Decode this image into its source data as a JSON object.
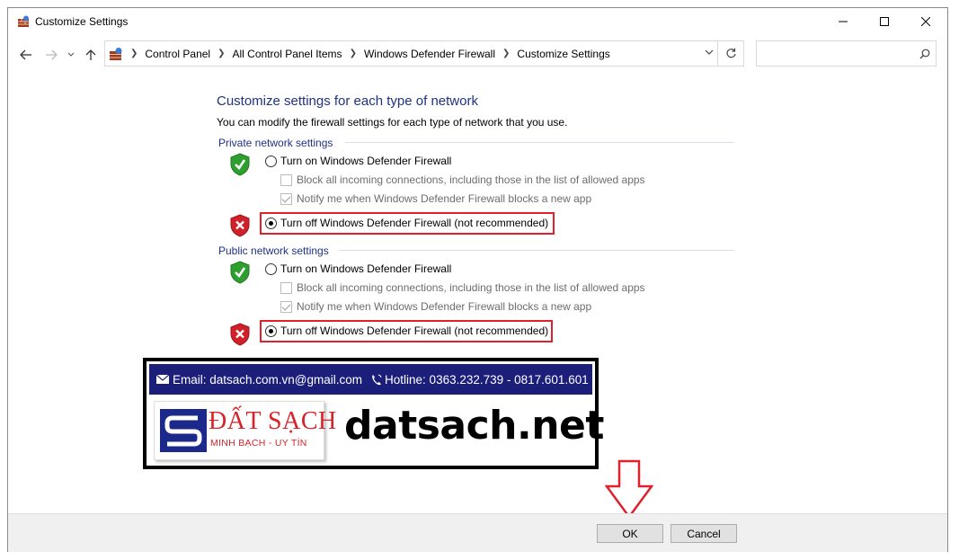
{
  "window": {
    "title": "Customize Settings"
  },
  "address_bar": {
    "breadcrumbs": [
      "Control Panel",
      "All Control Panel Items",
      "Windows Defender Firewall",
      "Customize Settings"
    ],
    "search_placeholder": ""
  },
  "content": {
    "heading": "Customize settings for each type of network",
    "description": "You can modify the firewall settings for each type of network that you use.",
    "private": {
      "title": "Private network settings",
      "turn_on_label": "Turn on Windows Defender Firewall",
      "turn_on_selected": false,
      "block_label": "Block all incoming connections, including those in the list of allowed apps",
      "block_checked": false,
      "notify_label": "Notify me when Windows Defender Firewall blocks a new app",
      "notify_checked": true,
      "turn_off_label": "Turn off Windows Defender Firewall (not recommended)",
      "turn_off_selected": true
    },
    "public": {
      "title": "Public network settings",
      "turn_on_label": "Turn on Windows Defender Firewall",
      "turn_on_selected": false,
      "block_label": "Block all incoming connections, including those in the list of allowed apps",
      "block_checked": false,
      "notify_label": "Notify me when Windows Defender Firewall blocks a new app",
      "notify_checked": true,
      "turn_off_label": "Turn off Windows Defender Firewall (not recommended)",
      "turn_off_selected": true
    }
  },
  "banner": {
    "email": "Email: datsach.com.vn@gmail.com",
    "hotline": "Hotline: 0363.232.739 - 0817.601.601",
    "logo_name": "ĐẤT SẠCH",
    "logo_tagline": "MINH BẠCH - UY TÍN",
    "site": "datsach.net"
  },
  "buttons": {
    "ok": "OK",
    "cancel": "Cancel"
  },
  "colors": {
    "heading": "#1e3287",
    "highlight": "#e0202a",
    "shield_green": "#2e9e2e",
    "shield_red": "#d0202a",
    "banner_blue": "#1b1f7a"
  },
  "icons": {
    "title": "firewall-icon",
    "shield_on": "green-shield-check-icon",
    "shield_off": "red-shield-x-icon"
  }
}
